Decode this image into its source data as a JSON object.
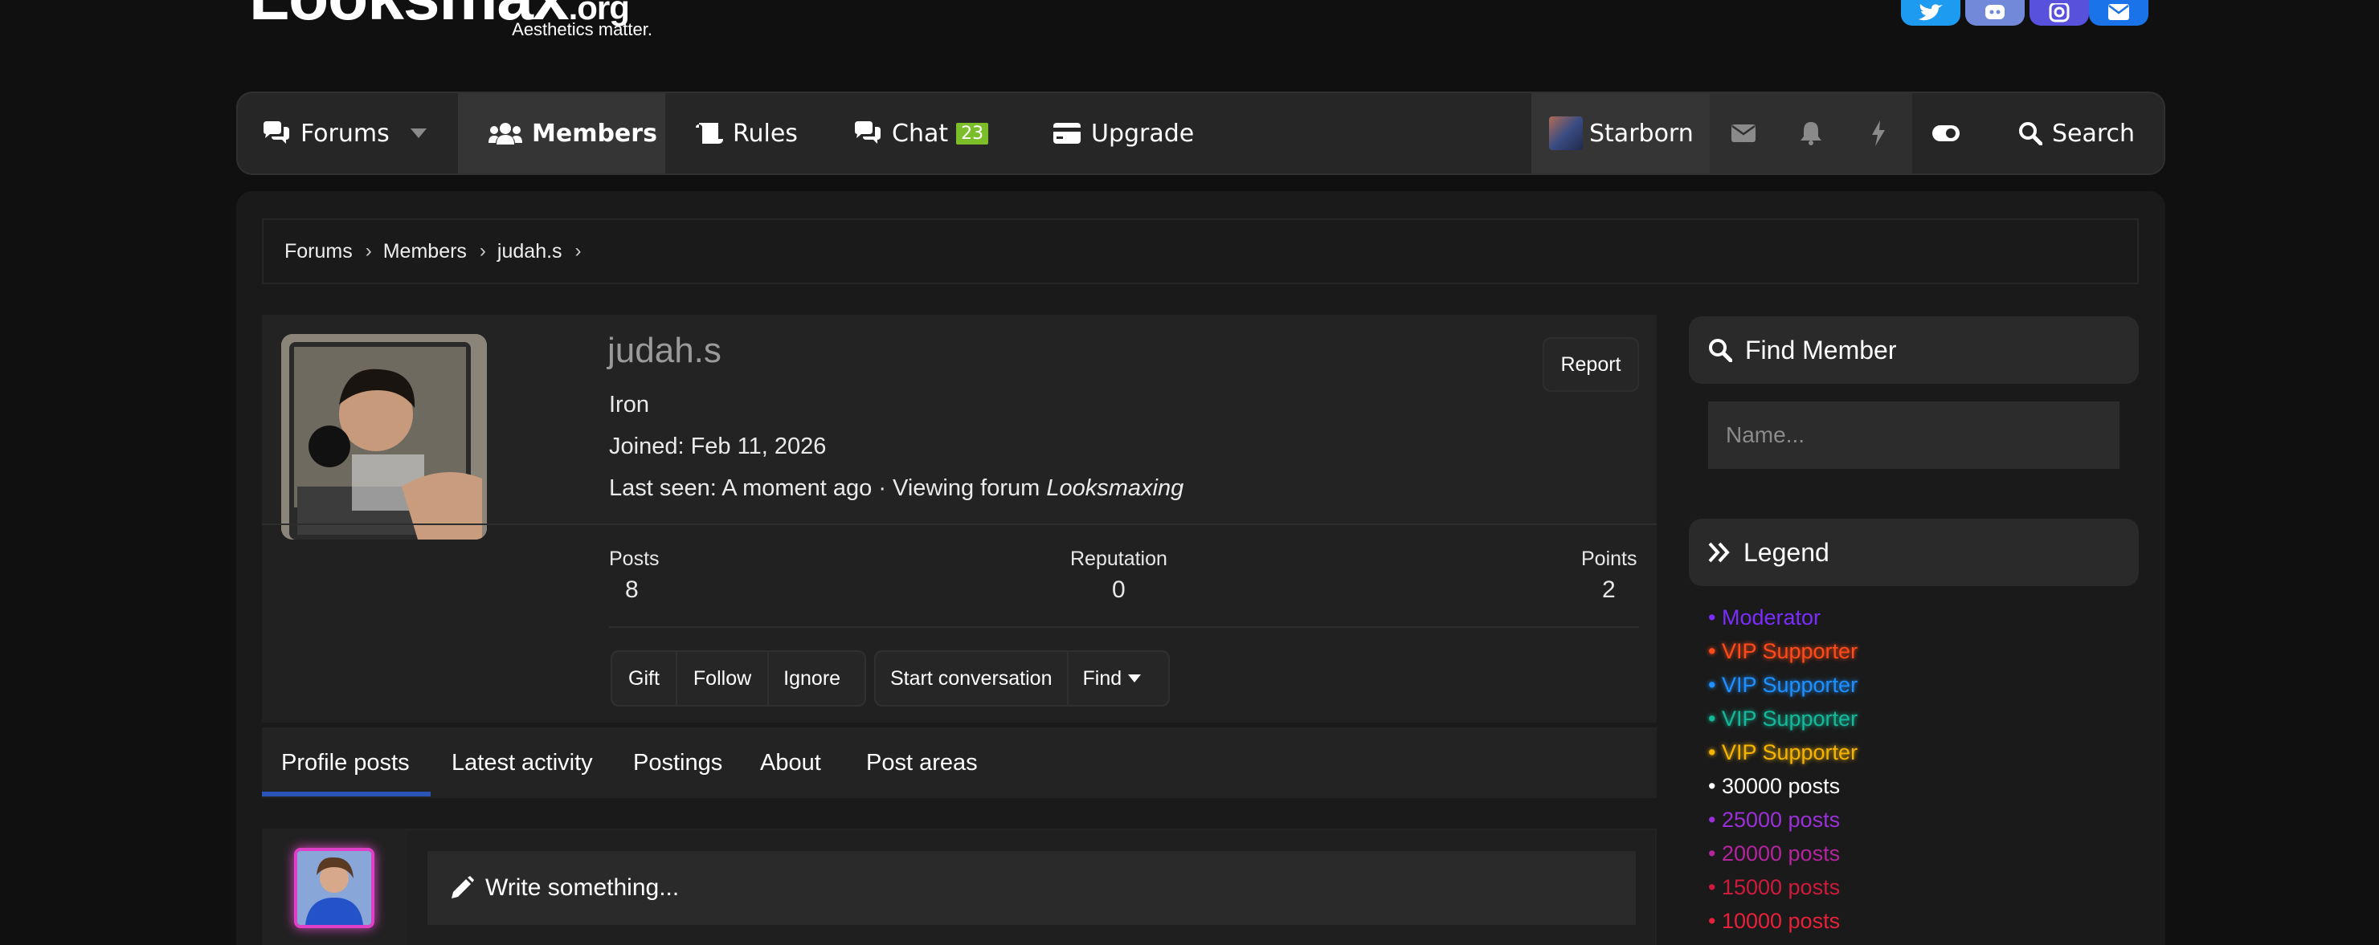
{
  "header": {
    "logo_text": "Looksmax",
    "logo_tld": ".org",
    "tagline": "Aesthetics matter."
  },
  "social": [
    {
      "name": "twitter",
      "color": "#1d9bf0"
    },
    {
      "name": "discord",
      "color": "#7289da"
    },
    {
      "name": "instagram",
      "color": "#5851db"
    },
    {
      "name": "email",
      "color": "#1a73e8"
    }
  ],
  "nav": {
    "forums": "Forums",
    "members": "Members",
    "rules": "Rules",
    "chat": "Chat",
    "chat_badge": "23",
    "upgrade": "Upgrade",
    "user": "Starborn",
    "search": "Search"
  },
  "breadcrumb": {
    "items": [
      "Forums",
      "Members",
      "judah.s"
    ]
  },
  "profile": {
    "username": "judah.s",
    "title": "Iron",
    "joined": "Joined: Feb 11, 2026",
    "last_seen_prefix": "Last seen: A moment ago · Viewing forum ",
    "last_seen_forum": "Looksmaxing",
    "report": "Report",
    "stats": {
      "posts_label": "Posts",
      "posts_value": "8",
      "reputation_label": "Reputation",
      "reputation_value": "0",
      "points_label": "Points",
      "points_value": "2"
    },
    "buttons": {
      "gift": "Gift",
      "follow": "Follow",
      "ignore": "Ignore",
      "start_conversation": "Start conversation",
      "find": "Find"
    }
  },
  "tabs": [
    "Profile posts",
    "Latest activity",
    "Postings",
    "About",
    "Post areas"
  ],
  "write": {
    "placeholder": "Write something..."
  },
  "sidebar": {
    "find_member": "Find Member",
    "name_placeholder": "Name...",
    "legend": "Legend",
    "legend_items": [
      {
        "label": "Moderator",
        "color": "#7b2cff"
      },
      {
        "label": "VIP Supporter",
        "color": "#ff4a1a"
      },
      {
        "label": "VIP Supporter",
        "color": "#1e90ff"
      },
      {
        "label": "VIP Supporter",
        "color": "#14b89a"
      },
      {
        "label": "VIP Supporter",
        "color": "#f5b400"
      },
      {
        "label": "30000 posts",
        "color": "#ffffff"
      },
      {
        "label": "25000 posts",
        "color": "#9b30d9"
      },
      {
        "label": "20000 posts",
        "color": "#b4249f"
      },
      {
        "label": "15000 posts",
        "color": "#d01a3c"
      },
      {
        "label": "10000 posts",
        "color": "#e8213a"
      }
    ]
  }
}
